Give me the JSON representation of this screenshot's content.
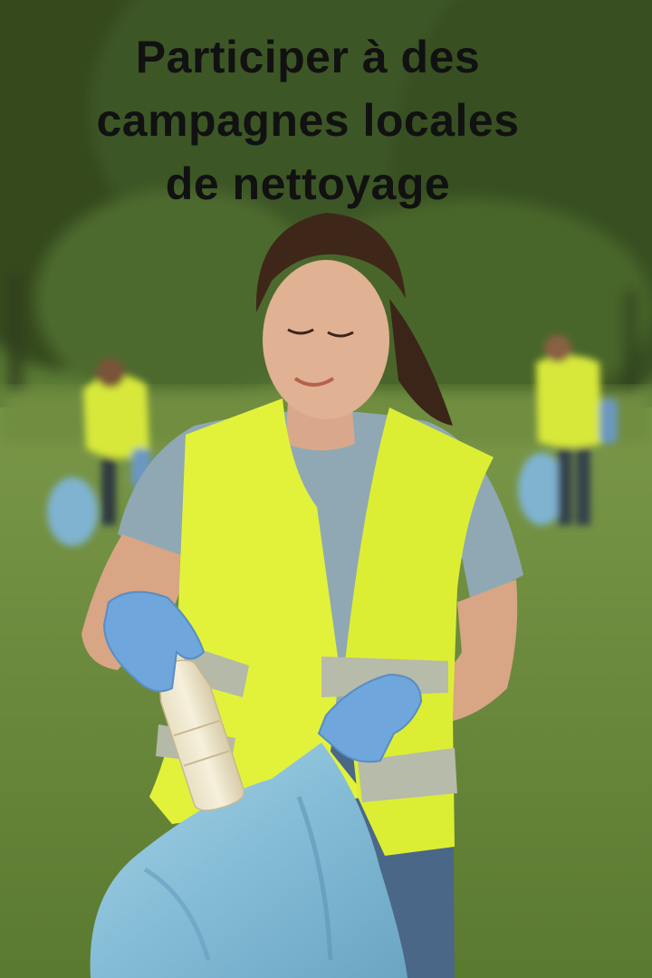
{
  "headline": {
    "lines": [
      "Participer à des",
      "campagnes locales",
      "de nettoyage"
    ]
  },
  "colors": {
    "vest": "#e2f23a",
    "tshirt": "#8fa8b4",
    "glove": "#6fa6dc",
    "trash_bag": "#8ec3dc",
    "grass": "#6a8a3e",
    "text": "#111111"
  },
  "scene": {
    "subject": "volunteer-woman-picking-up-bottle",
    "background_figures": [
      "volunteer-left-background",
      "volunteer-right-background"
    ]
  }
}
